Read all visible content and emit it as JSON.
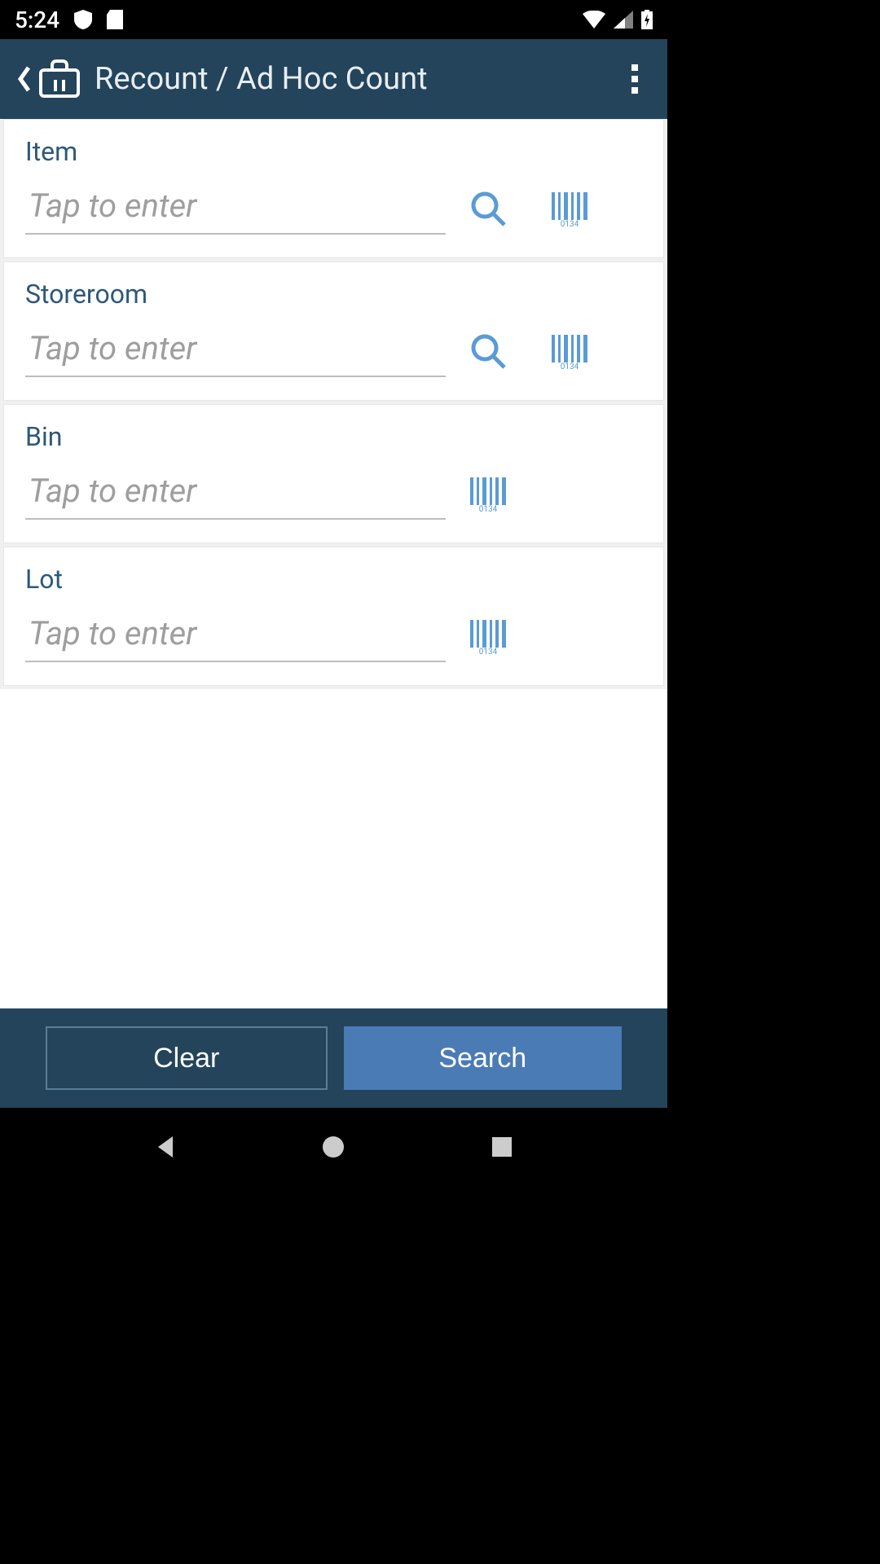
{
  "statusBar": {
    "time": "5:24"
  },
  "header": {
    "title": "Recount / Ad Hoc Count"
  },
  "fields": {
    "item": {
      "label": "Item",
      "placeholder": "Tap to enter"
    },
    "storeroom": {
      "label": "Storeroom",
      "placeholder": "Tap to enter"
    },
    "bin": {
      "label": "Bin",
      "placeholder": "Tap to enter"
    },
    "lot": {
      "label": "Lot",
      "placeholder": "Tap to enter"
    }
  },
  "buttons": {
    "clear": "Clear",
    "search": "Search"
  },
  "colors": {
    "headerBg": "#24445b",
    "accentBlue": "#4a7bb5",
    "fieldLabel": "#2d5879",
    "iconBlue": "#5a9bd5"
  },
  "barcodeLabel": "0134"
}
